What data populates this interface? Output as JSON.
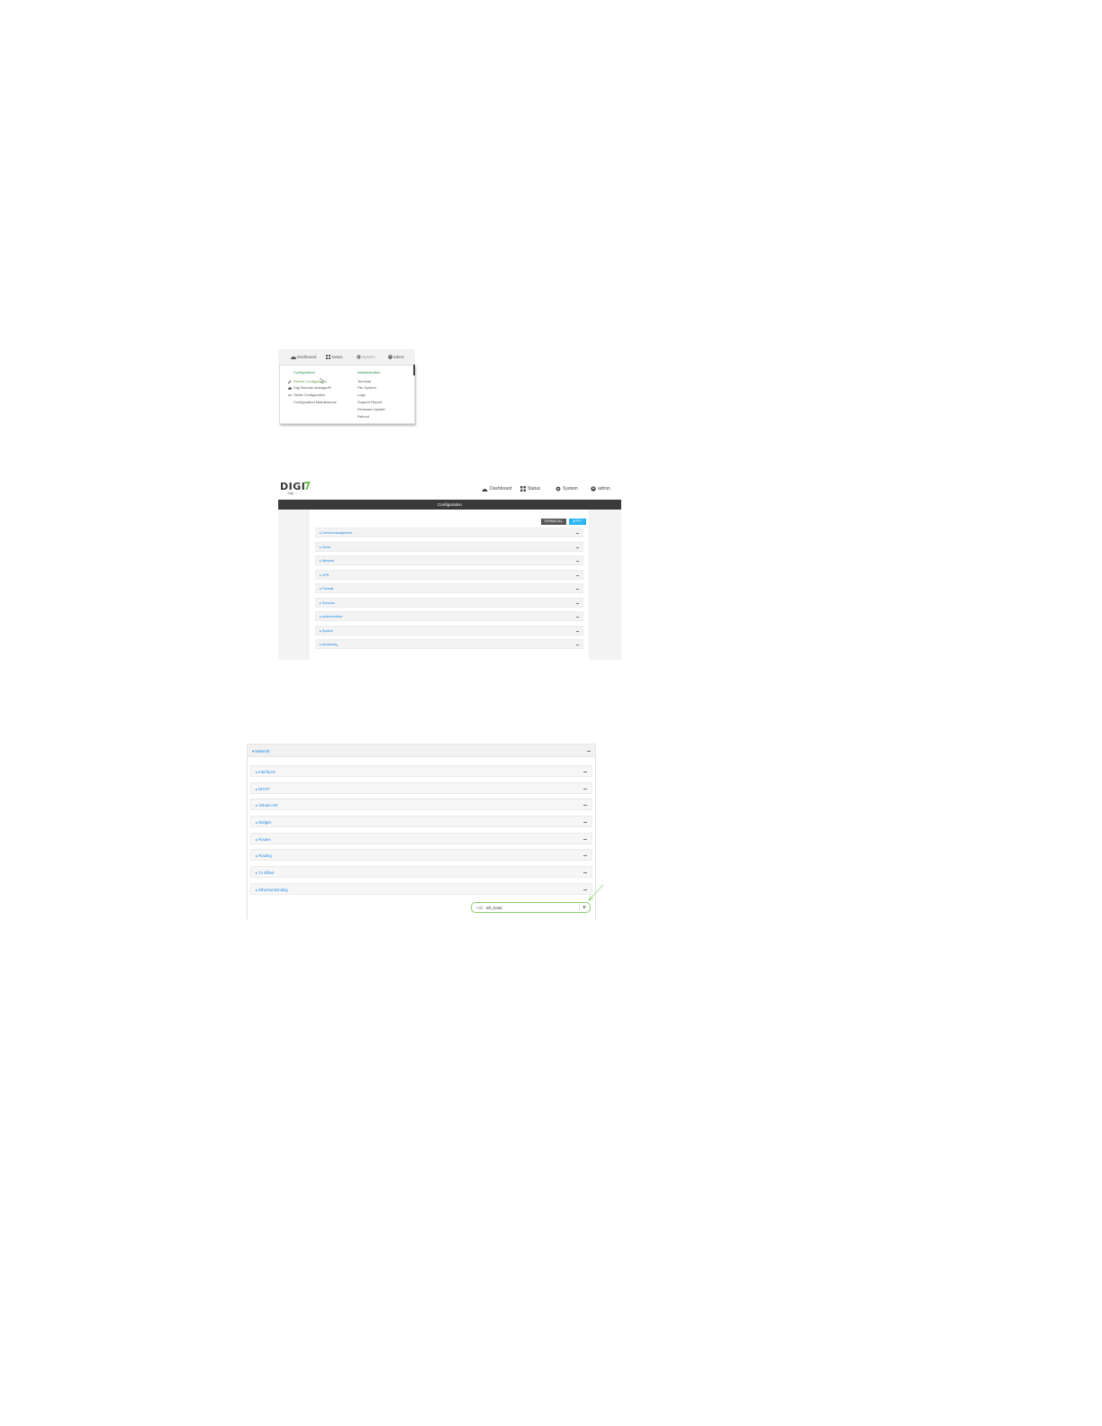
{
  "shot1": {
    "nav": {
      "dashboard": "Dashboard",
      "status": "Status",
      "system": "System",
      "admin": "admin"
    },
    "configuration_heading": "Configuration",
    "administration_heading": "Administration",
    "configuration_items": [
      {
        "label": "Device Configuration",
        "icon": "wrench-icon"
      },
      {
        "label": "Digi Remote Manager®",
        "icon": "cloud-icon"
      },
      {
        "label": "Serial Configuration",
        "icon": "serial-icon"
      },
      {
        "label": "Configuration Maintenance",
        "icon": ""
      }
    ],
    "administration_items": [
      "Terminal",
      "File System",
      "Logs",
      "Support Report",
      "Firmware Update",
      "Reboot"
    ]
  },
  "shot2": {
    "logo": "DIGI",
    "tagline": "Digi ...",
    "nav": {
      "dashboard": "Dashboard",
      "status": "Status",
      "system": "System",
      "admin": "admin"
    },
    "title": "Configuration",
    "buttons": {
      "expand_all": "EXPAND ALL",
      "apply": "APPLY"
    },
    "sections": [
      "Central management",
      "Serial",
      "Network",
      "VPN",
      "Firewall",
      "Services",
      "Authentication",
      "System",
      "Monitoring"
    ],
    "colors": {
      "accent_blue": "#29b6f6",
      "link_blue": "#1e88e5",
      "dark_bar": "#3a3a3a",
      "brand_green": "#6bbf47"
    }
  },
  "shot3": {
    "header": "Network",
    "subsections": [
      "Interfaces",
      "DHCP",
      "Virtual LAN",
      "Bridges",
      "Routes",
      "Routing",
      "Tx Offset",
      "Ethernet Bonding"
    ],
    "add_prefix": "Add",
    "add_value": "eth_bond",
    "add_button": "+"
  }
}
